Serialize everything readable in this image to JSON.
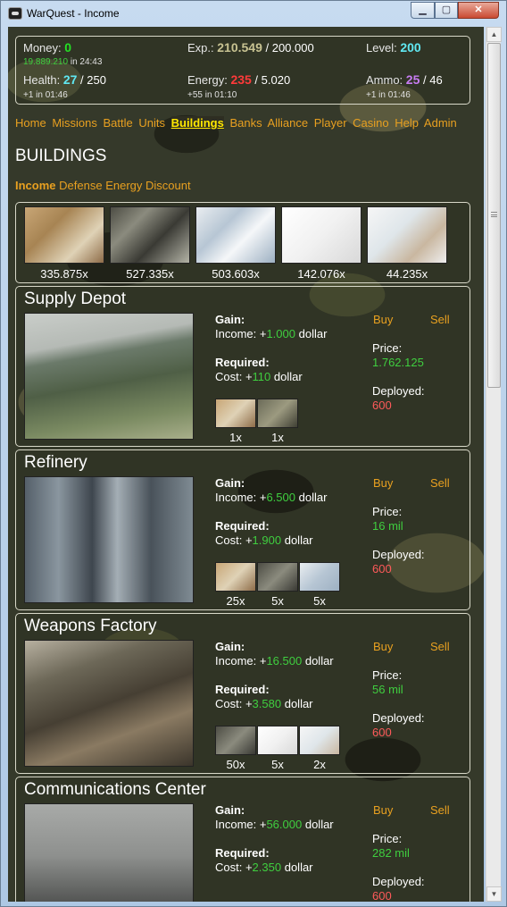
{
  "window": {
    "title": "WarQuest - Income",
    "min": "▁",
    "max": "▢",
    "close": "✕"
  },
  "stats": {
    "money_label": "Money:",
    "money_value": "0",
    "money_sub_value": "19.889.210",
    "money_sub_text": "in 24:43",
    "exp_label": "Exp.:",
    "exp_value": "210.549",
    "exp_max": "/ 200.000",
    "level_label": "Level:",
    "level_value": "200",
    "health_label": "Health:",
    "health_value": "27",
    "health_max": "/ 250",
    "health_sub": "+1 in 01:46",
    "energy_label": "Energy:",
    "energy_value": "235",
    "energy_max": "/ 5.020",
    "energy_sub": "+55 in 01:10",
    "ammo_label": "Ammo:",
    "ammo_value": "25",
    "ammo_max": "/ 46",
    "ammo_sub": "+1 in 01:46"
  },
  "nav": [
    "Home",
    "Missions",
    "Battle",
    "Units",
    "Buildings",
    "Banks",
    "Alliance",
    "Player",
    "Casino",
    "Help",
    "Admin"
  ],
  "nav_active": "Buildings",
  "page_title": "BUILDINGS",
  "subnav": [
    "Income",
    "Defense",
    "Energy",
    "Discount"
  ],
  "subnav_active": "Income",
  "strip": [
    "335.875x",
    "527.335x",
    "503.603x",
    "142.076x",
    "44.235x"
  ],
  "common": {
    "gain": "Gain:",
    "income": "Income: +",
    "dollar": "dollar",
    "required": "Required:",
    "cost": "Cost: +",
    "buy": "Buy",
    "sell": "Sell",
    "price": "Price:",
    "deployed": "Deployed:"
  },
  "buildings": [
    {
      "name": "Supply Depot",
      "income": "1.000",
      "cost": "110",
      "price": "1.762.125",
      "deployed": "600",
      "req": [
        "1x",
        "1x"
      ]
    },
    {
      "name": "Refinery",
      "income": "6.500",
      "cost": "1.900",
      "price": "16 mil",
      "deployed": "600",
      "req": [
        "25x",
        "5x",
        "5x"
      ]
    },
    {
      "name": "Weapons Factory",
      "income": "16.500",
      "cost": "3.580",
      "price": "56 mil",
      "deployed": "600",
      "req": [
        "50x",
        "5x",
        "2x"
      ]
    },
    {
      "name": "Communications Center",
      "income": "56.000",
      "cost": "2.350",
      "price": "282 mil",
      "deployed": "600",
      "req": []
    }
  ]
}
